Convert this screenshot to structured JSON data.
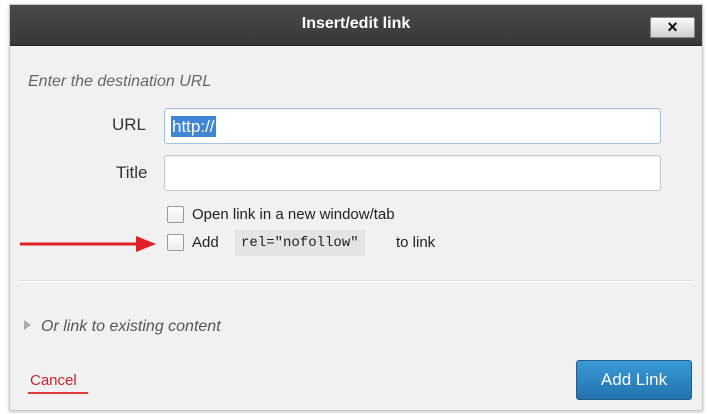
{
  "dialog": {
    "title": "Insert/edit link",
    "close_icon": "close-x-icon",
    "close_label": "×"
  },
  "form": {
    "prompt": "Enter the destination URL",
    "url_label": "URL",
    "url_value": "http://",
    "title_label": "Title",
    "title_value": "",
    "open_new_window": {
      "label": "Open link in a new window/tab",
      "checked": false
    },
    "nofollow": {
      "prefix": "Add",
      "code": "rel=\"nofollow\"",
      "suffix": "to link",
      "checked": false
    }
  },
  "annotation": {
    "arrow_color": "#e01f26",
    "arrow_icon": "red-arrow-icon"
  },
  "existing": {
    "label": "Or link to existing content",
    "icon": "triangle-right-icon"
  },
  "footer": {
    "cancel_label": "Cancel",
    "add_label": "Add Link"
  },
  "colors": {
    "titlebar": "#3c3c3c",
    "primary_button": "#2e86c1",
    "cancel": "#c6262b"
  }
}
